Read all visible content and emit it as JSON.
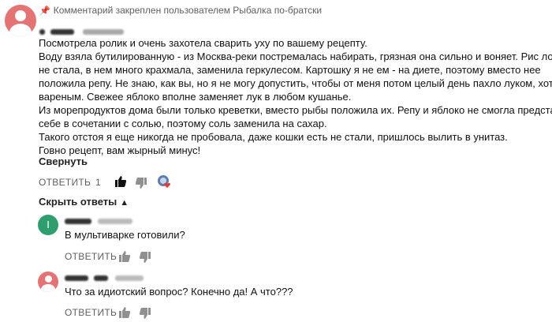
{
  "pinned": {
    "text": "Комментарий закреплен пользователем Рыбалка по-братски"
  },
  "comment": {
    "lines": [
      "Посмотрела ролик и очень захотела сварить уху по вашему рецепту.",
      "Воду взяла бутилированную - из Москва-реки постремалась набирать, грязная она сильно и воняет. Рис ложить",
      "не стала, в нем много крахмала, заменила геркулесом. Картошку я не ем - на диете, поэтому вместо нее",
      "положила репу. Не знаю, как вы, но я не могу допустить, чтобы от меня потом целый день пахло луком, хоть и",
      "вареным. Свежее яблоко вполне заменяет лук в любом кушанье.",
      "Из морепродуктов дома были только креветки, вместо рыбы положила их. Репу и яблоко не смогла представить",
      "себе в сочетании с солью, поэтому соль заменила на сахар.",
      "Такого отстоя я еще никогда не пробовала, даже кошки есть не стали, пришлось вылить в унитаз.",
      "Говно рецепт, вам жырный минус!"
    ],
    "collapse_label": "Свернуть",
    "reply_label": "ОТВЕТИТЬ",
    "like_count": "1"
  },
  "show_replies_label": "Скрыть ответы",
  "replies": [
    {
      "avatar_letter": "I",
      "text": "В мультиварке готовили?",
      "reply_label": "ОТВЕТИТЬ",
      "avatar_color": "#2e9e6e"
    },
    {
      "avatar_letter": "",
      "text": "Что за идиотский вопрос? Конечно да! А что???",
      "reply_label": "ОТВЕТИТЬ",
      "avatar_color": "#e57373"
    }
  ],
  "icons": [
    "pin-icon",
    "thumbs-up-icon",
    "thumbs-down-icon",
    "creator-heart-icon",
    "chevron-up-icon"
  ]
}
